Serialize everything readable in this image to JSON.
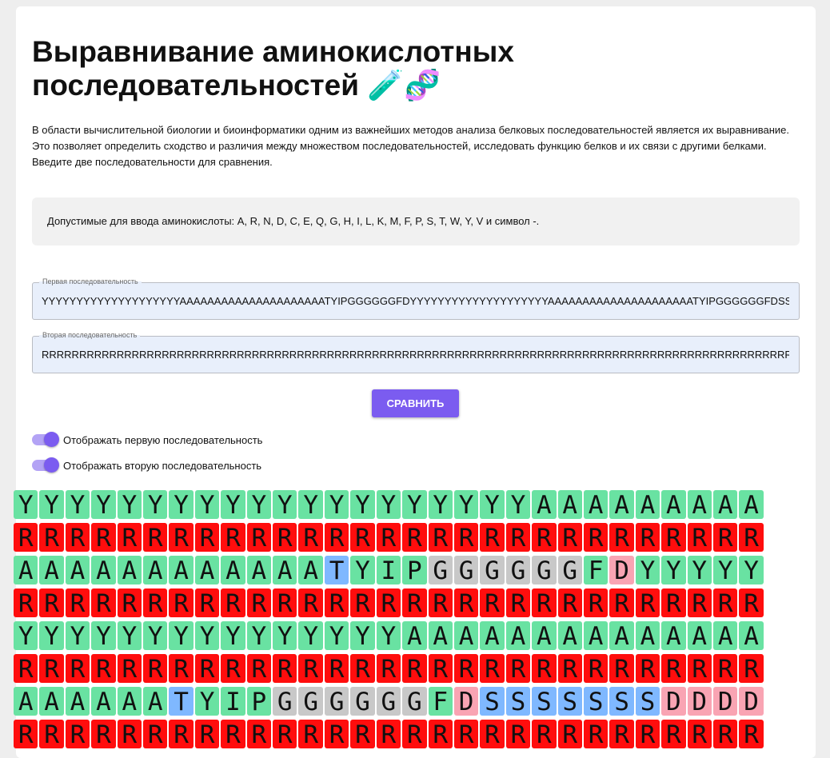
{
  "header": {
    "title": "Выравнивание аминокислотных последовательностей",
    "emojis": "🧪🧬"
  },
  "description": "В области вычислительной биологии и биоинформатики одним из важнейших методов анализа белковых последовательностей является их выравнивание. Это позволяет определить сходство и различия между множеством последовательностей, исследовать функцию белков и их связи с другими белками. Введите две последовательности для сравнения.",
  "note": "Допустимые для ввода аминокислоты: A, R, N, D, C, E, Q, G, H, I, L, K, M, F, P, S, T, W, Y, V и символ -.",
  "form": {
    "first": {
      "label": "Первая последовательность",
      "value": "YYYYYYYYYYYYYYYYYYYYAAAAAAAAAAAAAAAAAAAAATYIPGGGGGGFDYYYYYYYYYYYYYYYYYYYYAAAAAAAAAAAAAAAAAAAAATYIPGGGGGGFDSSSSSSSDDDD"
    },
    "second": {
      "label": "Вторая последовательность",
      "value": "RRRRRRRRRRRRRRRRRRRRRRRRRRRRRRRRRRRRRRRRRRRRRRRRRRRRRRRRRRRRRRRRRRRRRRRRRRRRRRRRRRRRRRRRRRRRRRRRRRRRRRRRRRRRRRRRRR"
    },
    "compare_label": "СРАВНИТЬ"
  },
  "toggles": [
    {
      "label": "Отображать первую последовательность",
      "on": true
    },
    {
      "label": "Отображать вторую последовательность",
      "on": true
    }
  ],
  "colors": {
    "accent": "#7b5cf0",
    "Y": "#69e2a2",
    "A": "#69e2a2",
    "I": "#69e2a2",
    "F": "#69e2a2",
    "R": "#ff0d0d",
    "T": "#7fb8ff",
    "S": "#7fb8ff",
    "P": "#69e2a2",
    "G": "#c8c8c8",
    "D": "#f9a4b3"
  },
  "alignment": {
    "rows_first": [
      "YYYYYYYYYYYYYYYYYYYYAAAAAAAAA",
      "AAAAAAAAAAAATYIPGGGGGGFDYYYYY",
      "YYYYYYYYYYYYYYYAAAAAAAAAAAAAA",
      "AAAAAATYIPGGGGGGFDSSSSSSSDDDD"
    ],
    "rows_second": [
      "RRRRRRRRRRRRRRRRRRRRRRRRRRRRR",
      "RRRRRRRRRRRRRRRRRRRRRRRRRRRRR",
      "RRRRRRRRRRRRRRRRRRRRRRRRRRRRR",
      "RRRRRRRRRRRRRRRRRRRRRRRRRRRRR"
    ]
  }
}
